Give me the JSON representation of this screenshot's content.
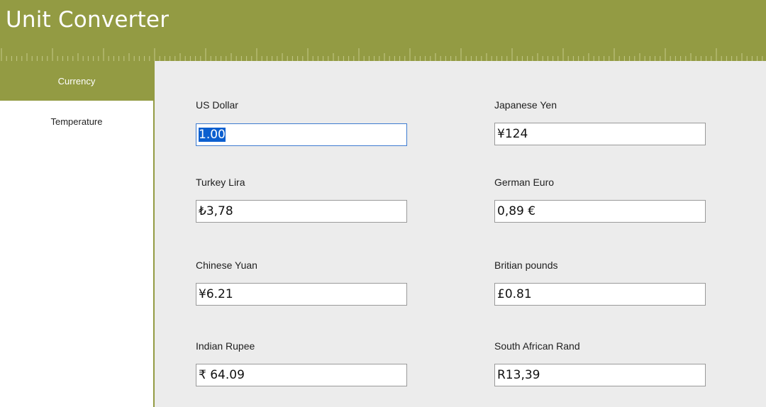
{
  "app": {
    "title": "Unit Converter"
  },
  "sidebar": {
    "items": [
      {
        "label": "Currency",
        "active": true
      },
      {
        "label": "Temperature",
        "active": false
      }
    ]
  },
  "currencies": [
    {
      "label": "US Dollar",
      "value": "1.00",
      "selected": true
    },
    {
      "label": "Japanese Yen",
      "value": "¥124"
    },
    {
      "label": "Turkey Lira",
      "value": "₺3,78"
    },
    {
      "label": "German Euro",
      "value": "0,89 €"
    },
    {
      "label": "Chinese Yuan",
      "value": "¥6.21"
    },
    {
      "label": "Britian pounds",
      "value": "£0.81"
    },
    {
      "label": "Indian Rupee",
      "value": "₹ 64.09"
    },
    {
      "label": "South African Rand",
      "value": "R13,39"
    }
  ],
  "colors": {
    "accent": "#939b43",
    "content_background": "#ececec",
    "focus_border": "#3d7bd0",
    "selection": "#0c5fcf"
  }
}
